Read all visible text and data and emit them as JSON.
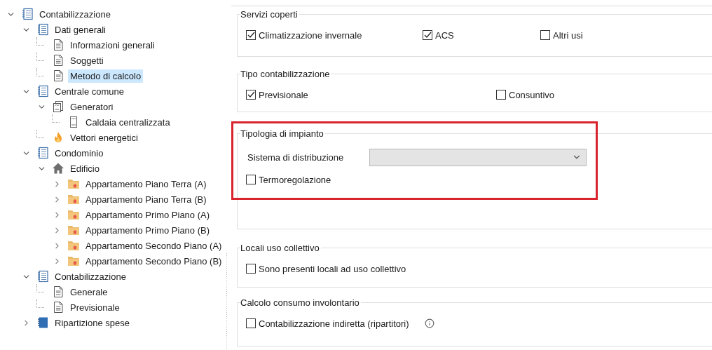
{
  "tree": [
    {
      "label": "Contabilizzazione",
      "kind": "section",
      "expanded": true,
      "selected": false,
      "children": [
        {
          "label": "Dati generali",
          "kind": "section",
          "expanded": true,
          "selected": false,
          "children": [
            {
              "label": "Informazioni generali",
              "kind": "page",
              "selected": false
            },
            {
              "label": "Soggetti",
              "kind": "page",
              "selected": false
            },
            {
              "label": "Metodo di calcolo",
              "kind": "page",
              "selected": true
            }
          ]
        },
        {
          "label": "Centrale comune",
          "kind": "section",
          "expanded": true,
          "selected": false,
          "children": [
            {
              "label": "Generatori",
              "kind": "generator",
              "expanded": true,
              "selected": false,
              "children": [
                {
                  "label": "Caldaia centralizzata",
                  "kind": "boiler",
                  "selected": false
                }
              ]
            },
            {
              "label": "Vettori energetici",
              "kind": "fuel",
              "selected": false
            }
          ]
        },
        {
          "label": "Condominio",
          "kind": "section",
          "expanded": true,
          "selected": false,
          "children": [
            {
              "label": "Edificio",
              "kind": "building",
              "expanded": true,
              "selected": false,
              "children": [
                {
                  "label": "Appartamento Piano Terra (A)",
                  "kind": "unit",
                  "expanded": false,
                  "selected": false
                },
                {
                  "label": "Appartamento Piano Terra (B)",
                  "kind": "unit",
                  "expanded": false,
                  "selected": false
                },
                {
                  "label": "Appartamento Primo Piano (A)",
                  "kind": "unit",
                  "expanded": false,
                  "selected": false
                },
                {
                  "label": "Appartamento Primo Piano (B)",
                  "kind": "unit",
                  "expanded": false,
                  "selected": false
                },
                {
                  "label": "Appartamento Secondo Piano (A)",
                  "kind": "unit",
                  "expanded": false,
                  "selected": false
                },
                {
                  "label": "Appartamento Secondo Piano (B)",
                  "kind": "unit",
                  "expanded": false,
                  "selected": false
                }
              ]
            }
          ]
        },
        {
          "label": "Contabilizzazione",
          "kind": "section",
          "expanded": true,
          "selected": false,
          "children": [
            {
              "label": "Generale",
              "kind": "page",
              "selected": false
            },
            {
              "label": "Previsionale",
              "kind": "page",
              "selected": false
            }
          ]
        },
        {
          "label": "Ripartizione spese",
          "kind": "module",
          "expanded": false,
          "selected": false
        }
      ]
    }
  ],
  "groups": [
    {
      "title": "Servizi coperti",
      "items": [
        {
          "kind": "checkbox",
          "label": "Climatizzazione invernale",
          "checked": true
        },
        {
          "kind": "checkbox",
          "label": "ACS",
          "checked": true
        },
        {
          "kind": "checkbox",
          "label": "Altri usi",
          "checked": false
        }
      ]
    },
    {
      "title": "Tipo contabilizzazione",
      "items": [
        {
          "kind": "checkbox",
          "label": "Previsionale",
          "checked": true
        },
        {
          "kind": "checkbox",
          "label": "Consuntivo",
          "checked": false
        }
      ]
    },
    {
      "title": "Tipologia di impianto",
      "items": [
        {
          "kind": "select",
          "label": "Sistema di distribuzione",
          "disabled": true
        },
        {
          "kind": "checkbox",
          "label": "Termoregolazione",
          "checked": false
        }
      ]
    },
    {
      "title": "Locali uso collettivo",
      "items": [
        {
          "kind": "checkbox",
          "label": "Sono presenti locali ad uso collettivo",
          "checked": false
        }
      ]
    },
    {
      "title": "Calcolo consumo involontario",
      "items": [
        {
          "kind": "checkbox",
          "label": "Contabilizzazione indiretta (ripartitori)",
          "checked": false,
          "info": true
        }
      ]
    }
  ]
}
